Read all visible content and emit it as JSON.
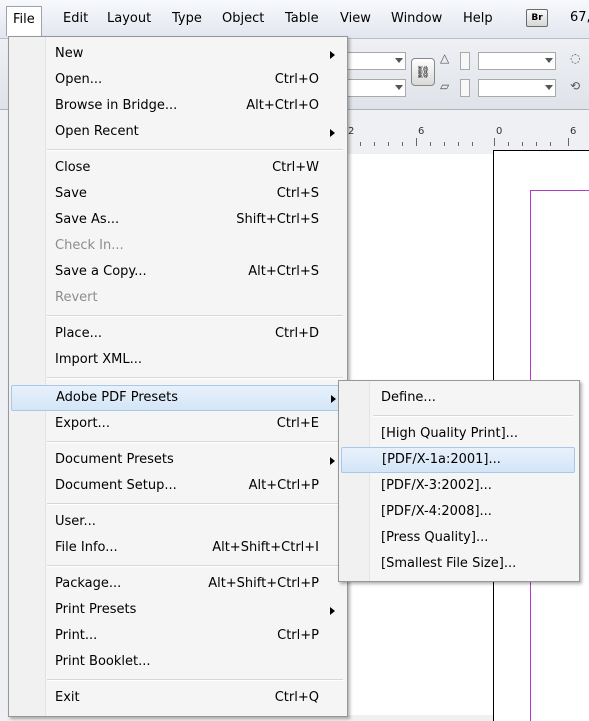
{
  "menubar": {
    "items": [
      "File",
      "Edit",
      "Layout",
      "Type",
      "Object",
      "Table",
      "View",
      "Window",
      "Help"
    ],
    "bridge_badge": "Br",
    "zoom": "67,"
  },
  "ruler": {
    "labels": [
      "2",
      "6",
      "0",
      "6"
    ]
  },
  "file_menu": {
    "new": "New",
    "open": "Open...",
    "open_sc": "Ctrl+O",
    "browse": "Browse in Bridge...",
    "browse_sc": "Alt+Ctrl+O",
    "open_recent": "Open Recent",
    "close": "Close",
    "close_sc": "Ctrl+W",
    "save": "Save",
    "save_sc": "Ctrl+S",
    "save_as": "Save As...",
    "save_as_sc": "Shift+Ctrl+S",
    "check_in": "Check In...",
    "save_copy": "Save a Copy...",
    "save_copy_sc": "Alt+Ctrl+S",
    "revert": "Revert",
    "place": "Place...",
    "place_sc": "Ctrl+D",
    "import_xml": "Import XML...",
    "pdf_presets": "Adobe PDF Presets",
    "export": "Export...",
    "export_sc": "Ctrl+E",
    "doc_presets": "Document Presets",
    "doc_setup": "Document Setup...",
    "doc_setup_sc": "Alt+Ctrl+P",
    "user": "User...",
    "file_info": "File Info...",
    "file_info_sc": "Alt+Shift+Ctrl+I",
    "package": "Package...",
    "package_sc": "Alt+Shift+Ctrl+P",
    "print_presets": "Print Presets",
    "print": "Print...",
    "print_sc": "Ctrl+P",
    "print_booklet": "Print Booklet...",
    "exit": "Exit",
    "exit_sc": "Ctrl+Q"
  },
  "pdf_submenu": {
    "define": "Define...",
    "high_quality": "[High Quality Print]...",
    "pdfx1a": "[PDF/X-1a:2001]...",
    "pdfx3": "[PDF/X-3:2002]...",
    "pdfx4": "[PDF/X-4:2008]...",
    "press": "[Press Quality]...",
    "smallest": "[Smallest File Size]..."
  }
}
